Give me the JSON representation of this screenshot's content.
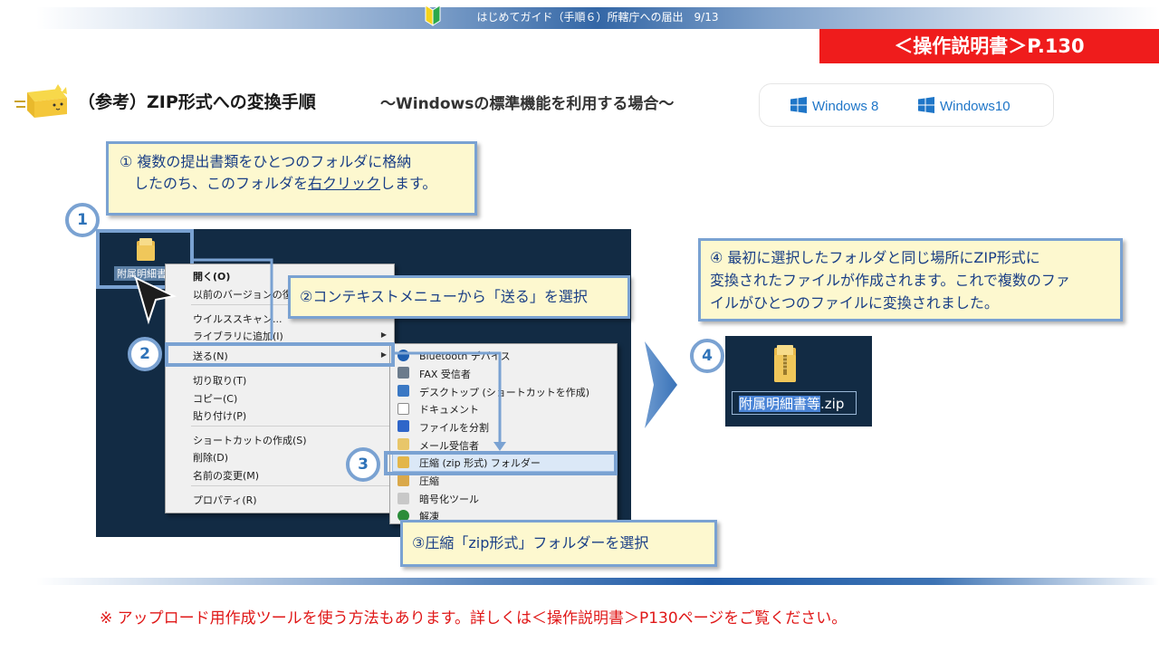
{
  "header": {
    "guide_title": "はじめてガイド（手順６）所轄庁への届出　9/13",
    "manual_ref": "＜操作説明書＞P.130"
  },
  "title": {
    "main": "（参考）ZIP形式への変換手順",
    "sub": "～Windowsの標準機能を利用する場合～"
  },
  "os_badges": [
    "Windows 8",
    "Windows10"
  ],
  "steps": {
    "step1_line1": "① 複数の提出書類をひとつのフォルダに格納",
    "step1_line2_pre": "したのち、このフォルダを",
    "step1_line2_link": "右クリック",
    "step1_line2_post": "します。",
    "step2": "②コンテキストメニューから「送る」を選択",
    "step3": "③圧縮「zip形式」フォルダーを選択",
    "step4_line1": "④ 最初に選択したフォルダと同じ場所にZIP形式に",
    "step4_line2": "変換されたファイルが作成されます。これで複数のファ",
    "step4_line3": "イルがひとつのファイルに変換されました。"
  },
  "numbers": [
    "1",
    "2",
    "3",
    "4"
  ],
  "desktop": {
    "folder_name": "附属明細書"
  },
  "context_menu": [
    {
      "label": "開く(O)",
      "bold": true
    },
    {
      "label": "以前のバージョンの復元(V)"
    },
    {
      "label": "ウイルススキャン..."
    },
    {
      "label": "ライブラリに追加(I)",
      "submenu": true
    },
    {
      "label": "送る(N)",
      "submenu": true
    },
    {
      "label": "切り取り(T)"
    },
    {
      "label": "コピー(C)"
    },
    {
      "label": "貼り付け(P)"
    },
    {
      "label": "ショートカットの作成(S)"
    },
    {
      "label": "削除(D)"
    },
    {
      "label": "名前の変更(M)"
    },
    {
      "label": "プロパティ(R)"
    }
  ],
  "send_to_menu": [
    {
      "label": "Bluetooth デバイス",
      "icon": "bluetooth-icon",
      "color": "#1f5fb0"
    },
    {
      "label": "FAX 受信者",
      "icon": "fax-icon",
      "color": "#6b7b8c"
    },
    {
      "label": "デスクトップ (ショートカットを作成)",
      "icon": "desktop-icon",
      "color": "#3a78c4"
    },
    {
      "label": "ドキュメント",
      "icon": "document-icon",
      "color": "#ffffff"
    },
    {
      "label": "ファイルを分割",
      "icon": "split-file-icon",
      "color": "#2f66c9"
    },
    {
      "label": "メール受信者",
      "icon": "mail-icon",
      "color": "#e8c66a"
    },
    {
      "label": "圧縮 (zip 形式) フォルダー",
      "icon": "zip-folder-icon",
      "color": "#e3b64a"
    },
    {
      "label": "圧縮",
      "icon": "compress-icon",
      "color": "#d9a84a"
    },
    {
      "label": "暗号化ツール",
      "icon": "encrypt-icon",
      "color": "#c8c8c8"
    },
    {
      "label": "解凍",
      "icon": "extract-icon",
      "color": "#2b8c3a"
    }
  ],
  "result": {
    "file_name_highlight": "附属明細書等",
    "file_ext": ".zip"
  },
  "footnote": "※ アップロード用作成ツールを使う方法もあります。詳しくは＜操作説明書＞P130ページをご覧ください。",
  "colors": {
    "accent_red": "#ef1c1c",
    "callout_bg": "#fdf8cf",
    "callout_border": "#7aa2d2",
    "desktop_bg": "#122b44",
    "win_blue": "#1f76c8"
  }
}
